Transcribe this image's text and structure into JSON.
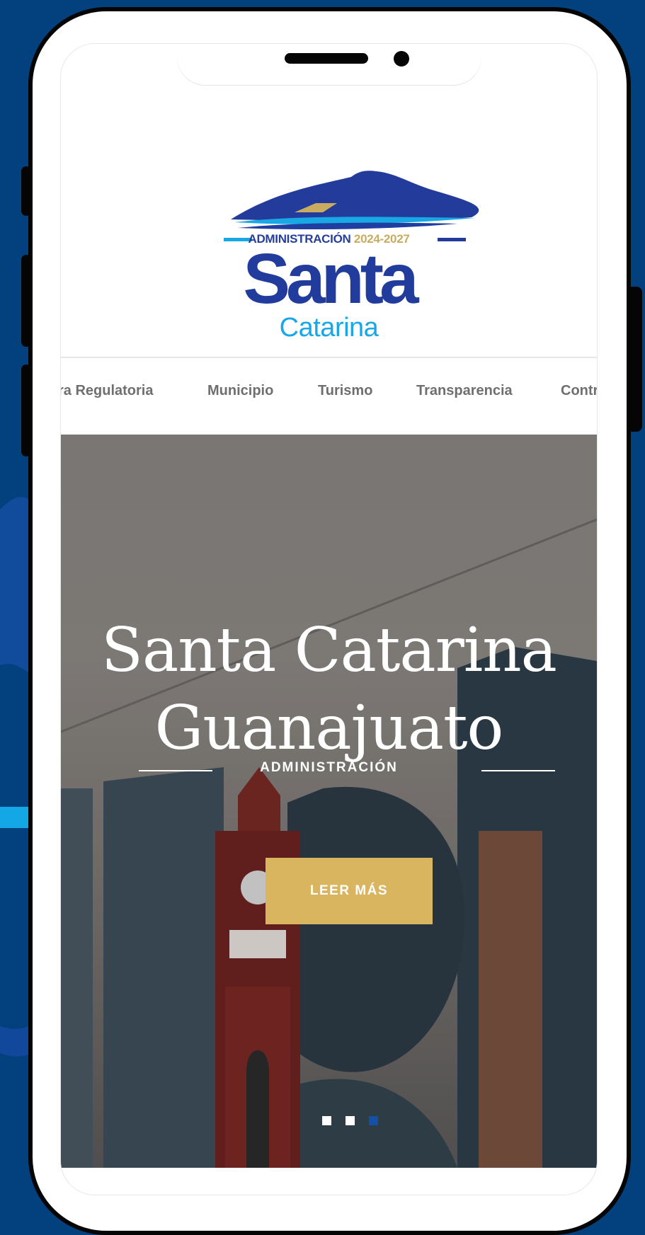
{
  "logo": {
    "admin_label": "ADMINISTRACIÓN",
    "admin_years": "2024-2027",
    "name_line1": "Santa",
    "name_line2": "Catarina"
  },
  "nav": {
    "items": [
      {
        "label": "ra Regulatoria"
      },
      {
        "label": "Municipio"
      },
      {
        "label": "Turismo"
      },
      {
        "label": "Transparencia"
      },
      {
        "label": "Contr"
      }
    ]
  },
  "hero": {
    "title_line1": "Santa Catarina",
    "title_line2": "Guanajuato",
    "subtitle": "ADMINISTRACIÓN",
    "cta_label": "LEER MÁS",
    "slides": {
      "count": 3,
      "active_index": 3
    }
  },
  "colors": {
    "page_background": "#03407e",
    "logo_blue": "#213c9c",
    "logo_light_blue": "#19a8e6",
    "logo_gold": "#c9ac5f",
    "cta_gold": "#d9b560",
    "dot_active": "#1351a8",
    "dot_inactive": "#ffffff"
  }
}
